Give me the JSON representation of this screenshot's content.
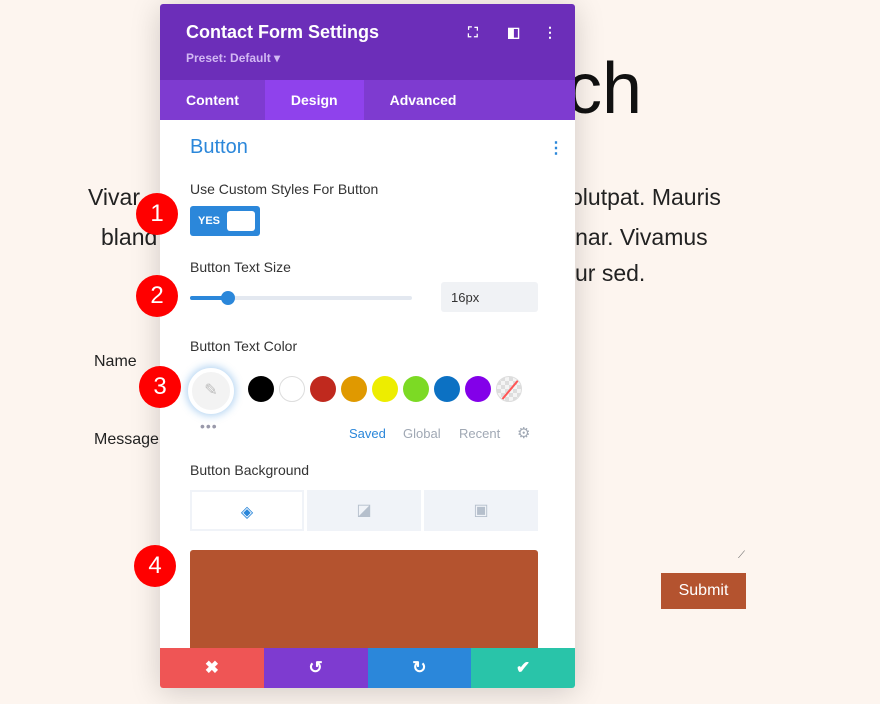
{
  "page": {
    "heading_fragment": "ch",
    "para_left": [
      "Vivar",
      "bland"
    ],
    "para_right": [
      "olutpat. Mauris",
      "inar. Vivamus",
      "ur sed."
    ],
    "name_label": "Name",
    "message_label": "Message",
    "submit": "Submit",
    "button_color": "#b4532f",
    "bg": "#fdf5ef"
  },
  "panel": {
    "title": "Contact Form Settings",
    "preset": "Preset: Default ▾",
    "tabs": [
      {
        "label": "Content"
      },
      {
        "label": "Design"
      },
      {
        "label": "Advanced"
      }
    ],
    "active_tab": "Design",
    "section": "Button",
    "custom_styles_label": "Use Custom Styles For Button",
    "toggle": "YES",
    "text_size_label": "Button Text Size",
    "text_size_value": "16px",
    "text_size_slider_percent": 17,
    "text_color_label": "Button Text Color",
    "swatches": [
      "#000000",
      "#ffffff",
      "#c0291e",
      "#e09900",
      "#eded00",
      "#7cda24",
      "#0c71c3",
      "#8300e9"
    ],
    "palette_tabs": [
      "Saved",
      "Global",
      "Recent"
    ],
    "background_label": "Button Background",
    "background_color": "#b4532f",
    "footer": {
      "colors": [
        "#ef5555",
        "#7e3bd0",
        "#2b87da",
        "#29c4a9"
      ]
    }
  },
  "annotations": [
    "1",
    "2",
    "3",
    "4"
  ]
}
